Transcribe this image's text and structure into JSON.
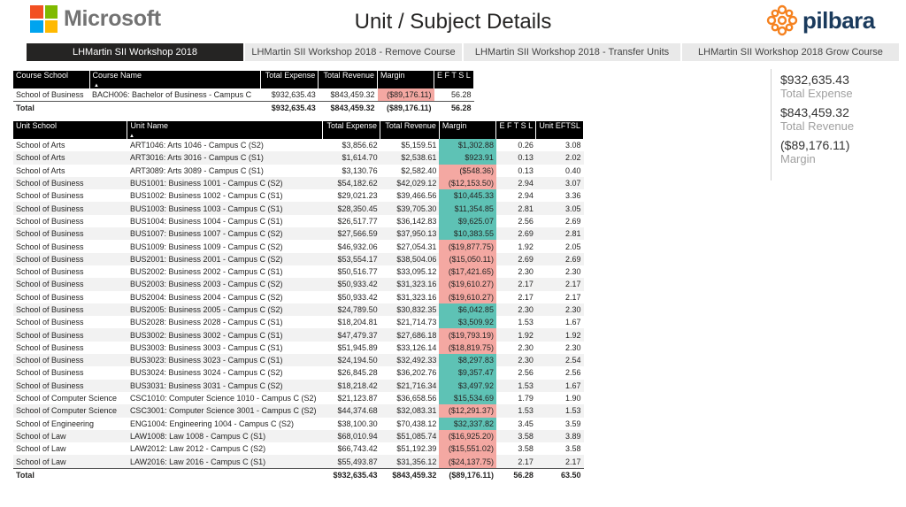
{
  "header": {
    "microsoft_logo_text": "Microsoft",
    "title": "Unit / Subject Details",
    "pilbara_logo_text": "pilbara",
    "ms_colors": [
      "#f25022",
      "#7fba00",
      "#00a4ef",
      "#ffb900"
    ],
    "pilbara_color": "#f58220"
  },
  "tabs": [
    {
      "label": "LHMartin SII Workshop 2018",
      "active": true
    },
    {
      "label": "LHMartin SII Workshop 2018 - Remove Course",
      "active": false
    },
    {
      "label": "LHMartin SII Workshop 2018 - Transfer Units",
      "active": false
    },
    {
      "label": "LHMartin SII Workshop 2018 Grow Course",
      "active": false
    }
  ],
  "course_table": {
    "headers": [
      "Course School",
      "Course Name",
      "Total Expense",
      "Total Revenue",
      "Margin",
      "E F T S L"
    ],
    "rows": [
      [
        "School of Business",
        "BACH006: Bachelor of Business - Campus C",
        "$932,635.43",
        "$843,459.32",
        "($89,176.11)",
        "56.28"
      ]
    ],
    "total": [
      "Total",
      "",
      "$932,635.43",
      "$843,459.32",
      "($89,176.11)",
      "56.28"
    ]
  },
  "unit_table": {
    "headers": [
      "Unit School",
      "Unit Name",
      "Total Expense",
      "Total Revenue",
      "Margin",
      "E F T S L",
      "Unit EFTSL"
    ],
    "rows": [
      [
        "School of Arts",
        "ART1046: Arts 1046 - Campus C (S2)",
        "$3,856.62",
        "$5,159.51",
        "$1,302.88",
        "0.26",
        "3.08"
      ],
      [
        "School of Arts",
        "ART3016: Arts 3016 - Campus C (S1)",
        "$1,614.70",
        "$2,538.61",
        "$923.91",
        "0.13",
        "2.02"
      ],
      [
        "School of Arts",
        "ART3089: Arts 3089 - Campus C (S1)",
        "$3,130.76",
        "$2,582.40",
        "($548.36)",
        "0.13",
        "0.40"
      ],
      [
        "School of Business",
        "BUS1001: Business 1001 - Campus C (S2)",
        "$54,182.62",
        "$42,029.12",
        "($12,153.50)",
        "2.94",
        "3.07"
      ],
      [
        "School of Business",
        "BUS1002: Business 1002 - Campus C (S1)",
        "$29,021.23",
        "$39,466.56",
        "$10,445.33",
        "2.94",
        "3.36"
      ],
      [
        "School of Business",
        "BUS1003: Business 1003 - Campus C (S1)",
        "$28,350.45",
        "$39,705.30",
        "$11,354.85",
        "2.81",
        "3.05"
      ],
      [
        "School of Business",
        "BUS1004: Business 1004 - Campus C (S1)",
        "$26,517.77",
        "$36,142.83",
        "$9,625.07",
        "2.56",
        "2.69"
      ],
      [
        "School of Business",
        "BUS1007: Business 1007 - Campus C (S2)",
        "$27,566.59",
        "$37,950.13",
        "$10,383.55",
        "2.69",
        "2.81"
      ],
      [
        "School of Business",
        "BUS1009: Business 1009 - Campus C (S2)",
        "$46,932.06",
        "$27,054.31",
        "($19,877.75)",
        "1.92",
        "2.05"
      ],
      [
        "School of Business",
        "BUS2001: Business 2001 - Campus C (S2)",
        "$53,554.17",
        "$38,504.06",
        "($15,050.11)",
        "2.69",
        "2.69"
      ],
      [
        "School of Business",
        "BUS2002: Business 2002 - Campus C (S1)",
        "$50,516.77",
        "$33,095.12",
        "($17,421.65)",
        "2.30",
        "2.30"
      ],
      [
        "School of Business",
        "BUS2003: Business 2003 - Campus C (S2)",
        "$50,933.42",
        "$31,323.16",
        "($19,610.27)",
        "2.17",
        "2.17"
      ],
      [
        "School of Business",
        "BUS2004: Business 2004 - Campus C (S2)",
        "$50,933.42",
        "$31,323.16",
        "($19,610.27)",
        "2.17",
        "2.17"
      ],
      [
        "School of Business",
        "BUS2005: Business 2005 - Campus C (S2)",
        "$24,789.50",
        "$30,832.35",
        "$6,042.85",
        "2.30",
        "2.30"
      ],
      [
        "School of Business",
        "BUS2028: Business 2028 - Campus C (S1)",
        "$18,204.81",
        "$21,714.73",
        "$3,509.92",
        "1.53",
        "1.67"
      ],
      [
        "School of Business",
        "BUS3002: Business 3002 - Campus C (S1)",
        "$47,479.37",
        "$27,686.18",
        "($19,793.19)",
        "1.92",
        "1.92"
      ],
      [
        "School of Business",
        "BUS3003: Business 3003 - Campus C (S1)",
        "$51,945.89",
        "$33,126.14",
        "($18,819.75)",
        "2.30",
        "2.30"
      ],
      [
        "School of Business",
        "BUS3023: Business 3023 - Campus C (S1)",
        "$24,194.50",
        "$32,492.33",
        "$8,297.83",
        "2.30",
        "2.54"
      ],
      [
        "School of Business",
        "BUS3024: Business 3024 - Campus C (S2)",
        "$26,845.28",
        "$36,202.76",
        "$9,357.47",
        "2.56",
        "2.56"
      ],
      [
        "School of Business",
        "BUS3031: Business 3031 - Campus C (S2)",
        "$18,218.42",
        "$21,716.34",
        "$3,497.92",
        "1.53",
        "1.67"
      ],
      [
        "School of Computer Science",
        "CSC1010: Computer Science 1010 - Campus C (S2)",
        "$21,123.87",
        "$36,658.56",
        "$15,534.69",
        "1.79",
        "1.90"
      ],
      [
        "School of Computer Science",
        "CSC3001: Computer Science 3001 - Campus C (S2)",
        "$44,374.68",
        "$32,083.31",
        "($12,291.37)",
        "1.53",
        "1.53"
      ],
      [
        "School of Engineering",
        "ENG1004: Engineering 1004 - Campus C (S2)",
        "$38,100.30",
        "$70,438.12",
        "$32,337.82",
        "3.45",
        "3.59"
      ],
      [
        "School of Law",
        "LAW1008: Law 1008 - Campus C (S1)",
        "$68,010.94",
        "$51,085.74",
        "($16,925.20)",
        "3.58",
        "3.89"
      ],
      [
        "School of Law",
        "LAW2012: Law 2012 - Campus C (S2)",
        "$66,743.42",
        "$51,192.39",
        "($15,551.02)",
        "3.58",
        "3.58"
      ],
      [
        "School of Law",
        "LAW2016: Law 2016 - Campus C (S1)",
        "$55,493.87",
        "$31,356.12",
        "($24,137.75)",
        "2.17",
        "2.17"
      ]
    ],
    "total": [
      "Total",
      "",
      "$932,635.43",
      "$843,459.32",
      "($89,176.11)",
      "56.28",
      "63.50"
    ]
  },
  "kpis": [
    {
      "value": "$932,635.43",
      "label": "Total Expense"
    },
    {
      "value": "$843,459.32",
      "label": "Total Revenue"
    },
    {
      "value": "($89,176.11)",
      "label": "Margin"
    }
  ],
  "colors": {
    "positive_margin": "#5ec2b5",
    "negative_margin": "#f4a8a2",
    "header_bg": "#000000",
    "active_tab": "#252423"
  }
}
